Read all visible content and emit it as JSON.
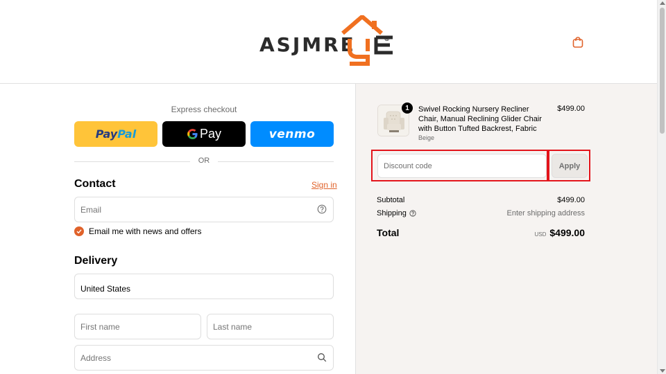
{
  "brand": {
    "name": "ASJMRE",
    "mark": "®",
    "accent_color": "#e0622a"
  },
  "express": {
    "title": "Express checkout",
    "paypal_part1": "Pay",
    "paypal_part2": "Pal",
    "gpay_label": "Pay",
    "venmo_label": "venmo",
    "or_label": "OR"
  },
  "contact": {
    "title": "Contact",
    "signin_label": "Sign in",
    "email_placeholder": "Email",
    "news_label": "Email me with news and offers"
  },
  "delivery": {
    "title": "Delivery",
    "country_value": "United States",
    "first_name_placeholder": "First name",
    "last_name_placeholder": "Last name",
    "address_placeholder": "Address"
  },
  "order": {
    "product_name": "Swivel Rocking Nursery Recliner Chair, Manual Reclining Glider Chair with Button Tufted Backrest, Fabric",
    "variant": "Beige",
    "quantity": "1",
    "price": "$499.00",
    "discount_placeholder": "Discount code",
    "apply_label": "Apply",
    "subtotal_label": "Subtotal",
    "subtotal_value": "$499.00",
    "shipping_label": "Shipping",
    "shipping_value": "Enter shipping address",
    "total_label": "Total",
    "currency": "USD",
    "total_value": "$499.00"
  }
}
